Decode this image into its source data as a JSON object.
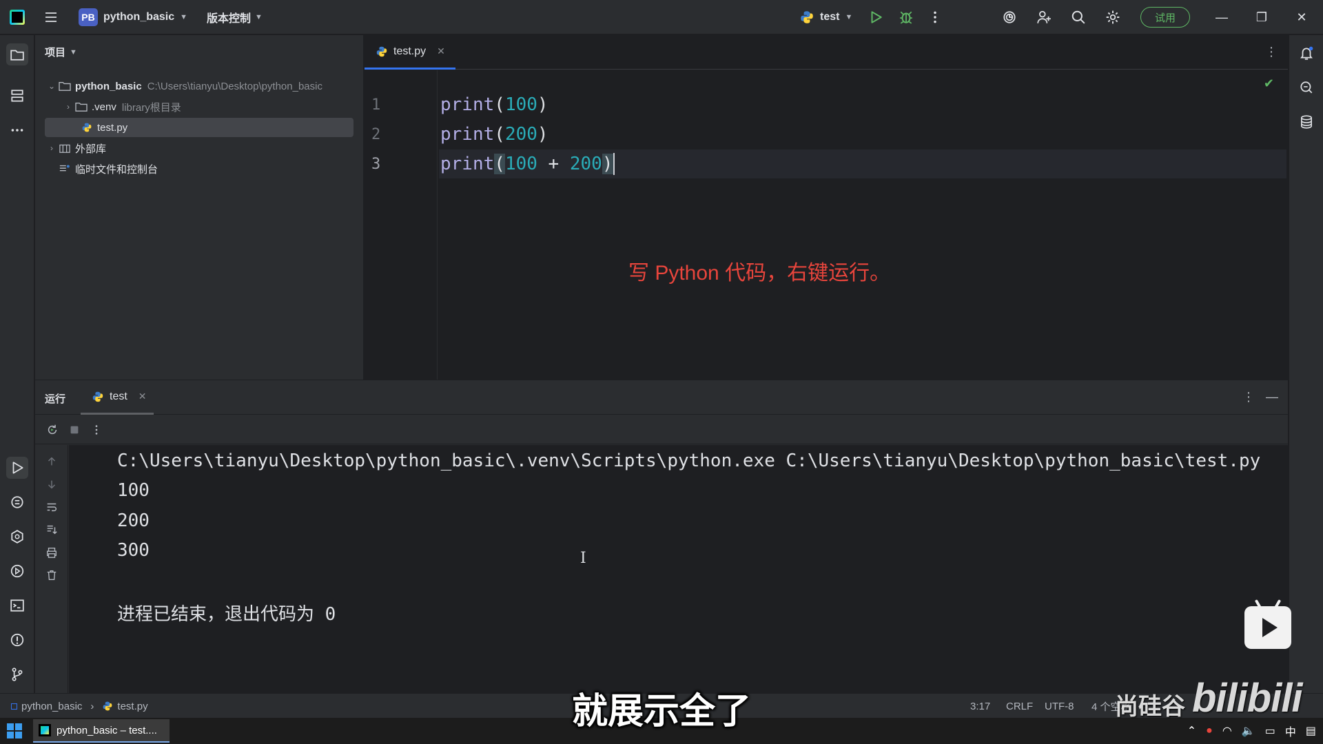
{
  "titlebar": {
    "project_badge": "PB",
    "project_name": "python_basic",
    "vcs_label": "版本控制",
    "run_config": "test",
    "trial_label": "试用"
  },
  "project_panel": {
    "header": "项目",
    "tree": [
      {
        "label": "python_basic",
        "sub": "C:\\Users\\tianyu\\Desktop\\python_basic"
      },
      {
        "label": ".venv",
        "sub": "library根目录"
      },
      {
        "label": "test.py",
        "sub": ""
      },
      {
        "label": "外部库",
        "sub": ""
      },
      {
        "label": "临时文件和控制台",
        "sub": ""
      }
    ]
  },
  "editor": {
    "tab_label": "test.py",
    "line_numbers": [
      "1",
      "2",
      "3"
    ],
    "lines": [
      {
        "fn": "print",
        "open": "(",
        "a": "100",
        "op": "",
        "b": "",
        "close": ")"
      },
      {
        "fn": "print",
        "open": "(",
        "a": "200",
        "op": "",
        "b": "",
        "close": ")"
      },
      {
        "fn": "print",
        "open": "(",
        "a": "100",
        "op": " + ",
        "b": "200",
        "close": ")"
      }
    ],
    "annotation": "写 Python 代码，右键运行。"
  },
  "run_panel": {
    "title": "运行",
    "tab_label": "test",
    "console": [
      "C:\\Users\\tianyu\\Desktop\\python_basic\\.venv\\Scripts\\python.exe C:\\Users\\tianyu\\Desktop\\python_basic\\test.py",
      "100",
      "200",
      "300",
      "进程已结束，退出代码为 0"
    ]
  },
  "statusbar": {
    "breadcrumb_project": "python_basic",
    "breadcrumb_file": "test.py",
    "position": "3:17",
    "line_sep": "CRLF",
    "encoding": "UTF-8",
    "indent": "4 个空格"
  },
  "taskbar": {
    "app_label": "python_basic – test...."
  },
  "overlay": {
    "subtitle": "就展示全了",
    "watermark_cn": "尚硅谷",
    "watermark_en": "bilibili"
  },
  "colors": {
    "accent": "#3574f0",
    "annotation": "#e8453c",
    "success": "#5fb865",
    "number": "#2aacb8",
    "function": "#b3aee6"
  }
}
